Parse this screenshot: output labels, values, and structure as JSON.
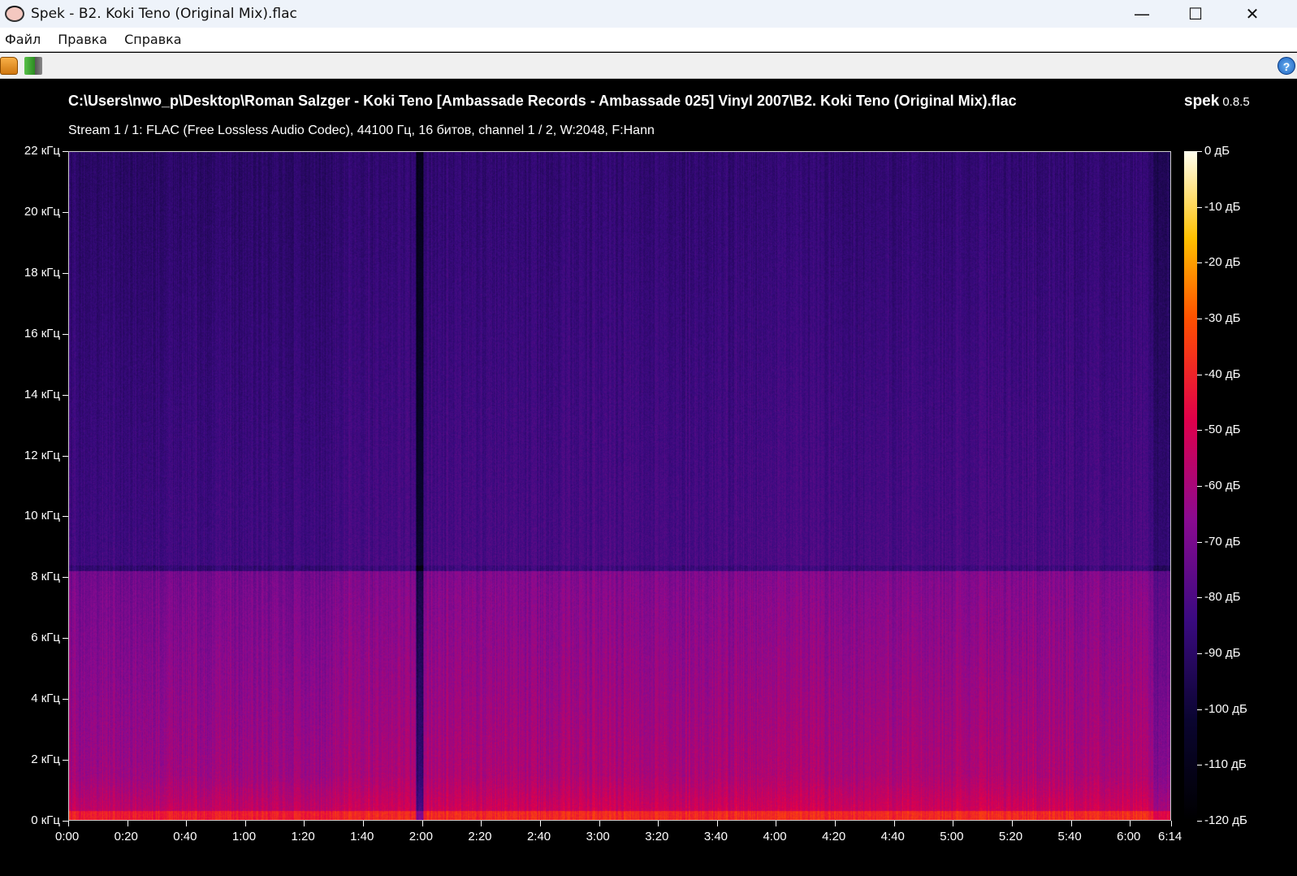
{
  "window": {
    "title": "Spek - B2. Koki Teno (Original Mix).flac",
    "minimize": "—",
    "maximize": "☐",
    "close": "✕"
  },
  "menu": [
    "Файл",
    "Правка",
    "Справка"
  ],
  "toolbar": {
    "open": "folder-open-icon",
    "reload": "reload-icon",
    "help": "?"
  },
  "header": {
    "path": "C:\\Users\\nwo_p\\Desktop\\Roman Salzger - Koki Teno [Ambassade Records - Ambassade 025] Vinyl 2007\\B2. Koki Teno (Original Mix).flac",
    "stream": "Stream 1 / 1: FLAC (Free Lossless Audio Codec), 44100 Гц, 16 битов, channel 1 / 2, W:2048, F:Hann",
    "brand": "spek",
    "version": "0.8.5"
  },
  "freq_ticks": [
    "0 кГц",
    "2 кГц",
    "4 кГц",
    "6 кГц",
    "8 кГц",
    "10 кГц",
    "12 кГц",
    "14 кГц",
    "16 кГц",
    "18 кГц",
    "20 кГц",
    "22 кГц"
  ],
  "time_ticks": [
    "0:00",
    "0:20",
    "0:40",
    "1:00",
    "1:20",
    "1:40",
    "2:00",
    "2:20",
    "2:40",
    "3:00",
    "3:20",
    "3:40",
    "4:00",
    "4:20",
    "4:40",
    "5:00",
    "5:20",
    "5:40",
    "6:00",
    "6:14"
  ],
  "time_seconds": [
    0,
    20,
    40,
    60,
    80,
    100,
    120,
    140,
    160,
    180,
    200,
    220,
    240,
    260,
    280,
    300,
    320,
    340,
    360,
    374
  ],
  "duration_seconds": 374,
  "max_freq_khz": 22,
  "db_ticks": [
    "0 дБ",
    "-10 дБ",
    "-20 дБ",
    "-30 дБ",
    "-40 дБ",
    "-50 дБ",
    "-60 дБ",
    "-70 дБ",
    "-80 дБ",
    "-90 дБ",
    "-100 дБ",
    "-110 дБ",
    "-120 дБ"
  ]
}
